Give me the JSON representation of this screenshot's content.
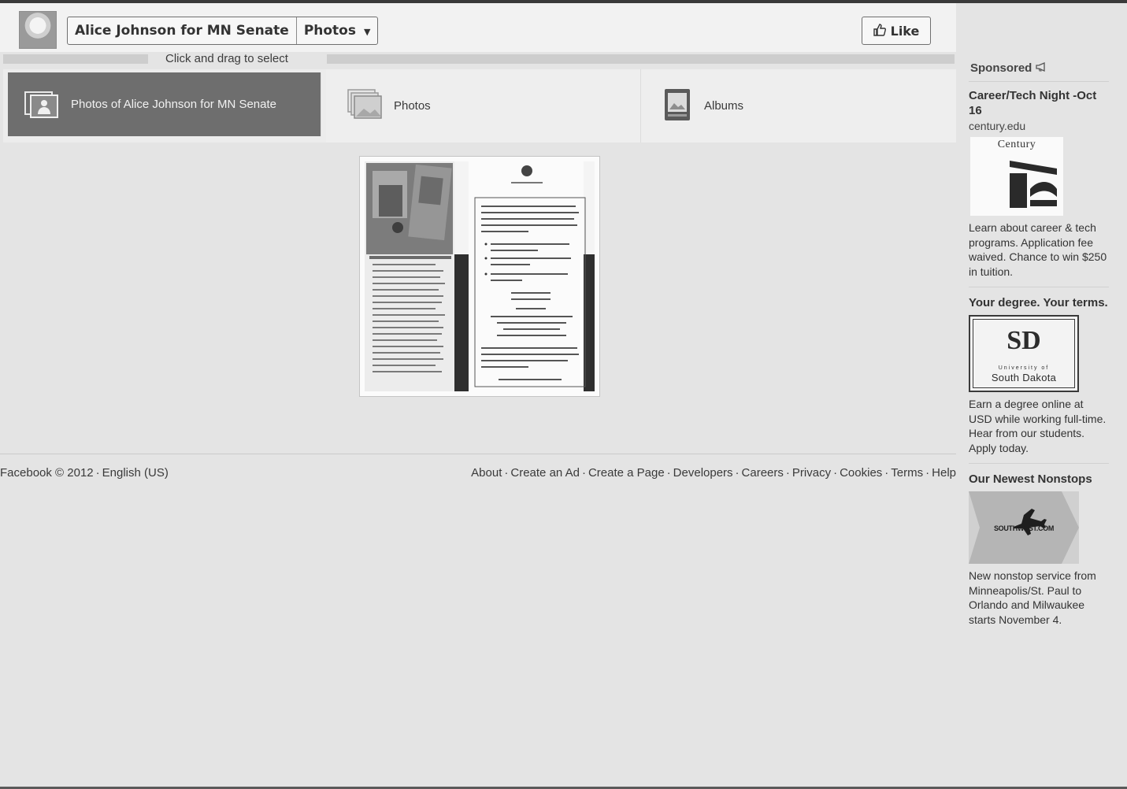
{
  "header": {
    "page_name": "Alice Johnson for MN Senate",
    "section": "Photos",
    "like_label": "Like"
  },
  "select_hint": "Click and drag to select",
  "tabs": [
    {
      "label": "Photos of Alice Johnson for MN Senate",
      "icon": "photo-of-person-icon",
      "active": true
    },
    {
      "label": "Photos",
      "icon": "photos-stack-icon",
      "active": false
    },
    {
      "label": "Albums",
      "icon": "album-icon",
      "active": false
    }
  ],
  "footer": {
    "copyright": "Facebook © 2012",
    "language": "English (US)",
    "links": [
      "About",
      "Create an Ad",
      "Create a Page",
      "Developers",
      "Careers",
      "Privacy",
      "Cookies",
      "Terms",
      "Help"
    ]
  },
  "sponsored": {
    "heading": "Sponsored",
    "ads": [
      {
        "title": "Career/Tech Night -Oct 16",
        "domain": "century.edu",
        "logo_text": "Century",
        "body": "Learn about career & tech programs. Application fee waived. Chance to win $250 in tuition."
      },
      {
        "title": "Your degree. Your terms.",
        "domain": "",
        "logo_text": "South Dakota",
        "logo_subtext": "University of",
        "body": "Earn a degree online at USD while working full-time. Hear from our students. Apply today."
      },
      {
        "title": "Our Newest Nonstops",
        "domain": "",
        "logo_text": "SOUTHWEST.COM",
        "body": "New nonstop service from Minneapolis/St. Paul to Orlando and Milwaukee starts November 4."
      }
    ]
  },
  "colors": {
    "page_bg": "#e4e4e4",
    "active_tab": "#6e6e6e",
    "header_bg": "#f2f2f2"
  }
}
